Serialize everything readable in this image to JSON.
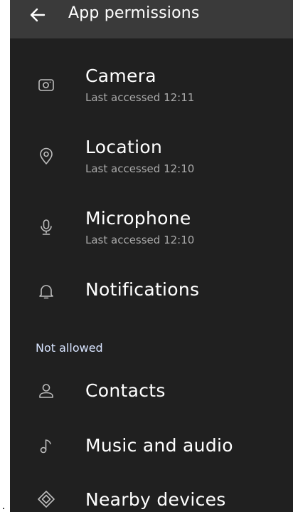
{
  "header": {
    "title": "App permissions",
    "back_icon": "arrow-left-icon"
  },
  "allowed": [
    {
      "label": "Camera",
      "subtitle": "Last accessed 12:11",
      "icon": "camera-icon"
    },
    {
      "label": "Location",
      "subtitle": "Last accessed 12:10",
      "icon": "location-pin-icon"
    },
    {
      "label": "Microphone",
      "subtitle": "Last accessed 12:10",
      "icon": "microphone-icon"
    },
    {
      "label": "Notifications",
      "icon": "bell-icon"
    }
  ],
  "not_allowed": {
    "header": "Not allowed",
    "items": [
      {
        "label": "Contacts",
        "icon": "person-icon"
      },
      {
        "label": "Music and audio",
        "icon": "music-note-icon"
      },
      {
        "label": "Nearby devices",
        "icon": "nearby-devices-icon"
      }
    ]
  },
  "colors": {
    "background": "#202020",
    "topbar": "#3a3a3a",
    "text": "#ffffff",
    "subtext": "#a9a9a9",
    "section_header": "#d8e4ff"
  }
}
